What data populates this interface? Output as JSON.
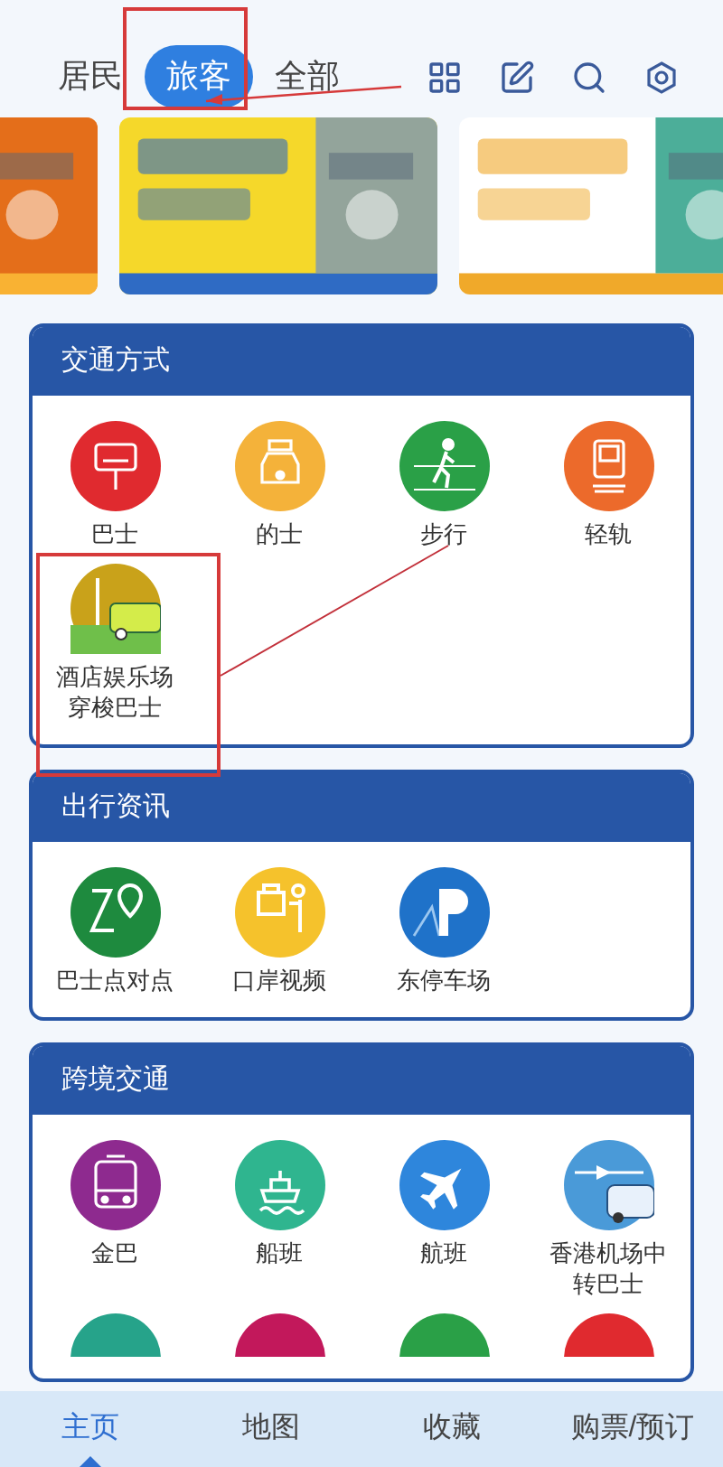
{
  "top_tabs": [
    {
      "label": "居民",
      "selected": false
    },
    {
      "label": "旅客",
      "selected": true
    },
    {
      "label": "全部",
      "selected": false
    }
  ],
  "sections": [
    {
      "title": "交通方式",
      "items": [
        {
          "label": "巴士",
          "kind": "bus",
          "color": "#e02a2f"
        },
        {
          "label": "的士",
          "kind": "taxi",
          "color": "#f4b23a"
        },
        {
          "label": "步行",
          "kind": "walk",
          "color": "#2aa047"
        },
        {
          "label": "轻轨",
          "kind": "rail",
          "color": "#ec6a2b"
        },
        {
          "label": "酒店娱乐场穿梭巴士",
          "kind": "shuttle",
          "color": "#c9a21a"
        }
      ]
    },
    {
      "title": "出行资讯",
      "items": [
        {
          "label": "巴士点对点",
          "kind": "route",
          "color": "#1e8a3e"
        },
        {
          "label": "口岸视频",
          "kind": "border",
          "color": "#f5c22c"
        },
        {
          "label": "东停车场",
          "kind": "parking",
          "color": "#1f72c9"
        }
      ]
    },
    {
      "title": "跨境交通",
      "items": [
        {
          "label": "金巴",
          "kind": "coach",
          "color": "#8e2a8f"
        },
        {
          "label": "船班",
          "kind": "ferry",
          "color": "#2fb58f"
        },
        {
          "label": "航班",
          "kind": "plane",
          "color": "#2e86dc"
        },
        {
          "label": "香港机场中转巴士",
          "kind": "airport",
          "color": "#4a9ad8"
        },
        {
          "kind": "cut",
          "color": "#26a38a"
        },
        {
          "kind": "cut",
          "color": "#c2185b"
        },
        {
          "kind": "cut",
          "color": "#2aa047"
        },
        {
          "kind": "cut",
          "color": "#e02a2f"
        }
      ]
    }
  ],
  "bottom_nav": [
    {
      "label": "主页",
      "selected": true
    },
    {
      "label": "地图",
      "selected": false
    },
    {
      "label": "收藏",
      "selected": false
    },
    {
      "label": "购票/预订",
      "selected": false
    }
  ]
}
